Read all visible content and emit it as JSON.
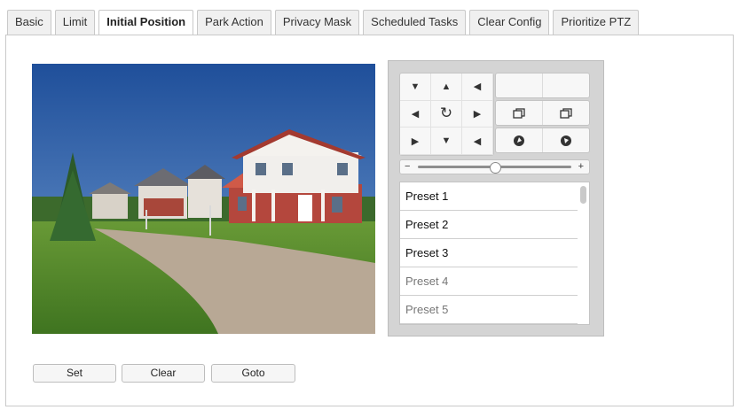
{
  "tabs": [
    {
      "label": "Basic",
      "active": false
    },
    {
      "label": "Limit",
      "active": false
    },
    {
      "label": "Initial Position",
      "active": true
    },
    {
      "label": "Park Action",
      "active": false
    },
    {
      "label": "Privacy Mask",
      "active": false
    },
    {
      "label": "Scheduled Tasks",
      "active": false
    },
    {
      "label": "Clear Config",
      "active": false
    },
    {
      "label": "Prioritize PTZ",
      "active": false
    }
  ],
  "video": {
    "scene": "house-with-lawn-and-road"
  },
  "ptz": {
    "direction_icons": [
      "up-left-arrow-icon",
      "up-arrow-icon",
      "up-right-arrow-icon",
      "left-arrow-icon",
      "auto-rotate-icon",
      "right-arrow-icon",
      "down-left-arrow-icon",
      "down-arrow-icon",
      "down-right-arrow-icon"
    ],
    "direction_glyphs": [
      "▼",
      "▲",
      "◀",
      "◀",
      "↻",
      "▶",
      "▶",
      "▼",
      "◀"
    ],
    "speed_slider": {
      "minus": "−",
      "plus": "+",
      "level": 0.5
    },
    "presets": [
      "Preset 1",
      "Preset 2",
      "Preset 3",
      "Preset 4",
      "Preset 5"
    ]
  },
  "actions": {
    "set_label": "Set",
    "clear_label": "Clear",
    "goto_label": "Goto"
  },
  "colors": {
    "sky": "#2f62a8",
    "grass": "#5a8f2e",
    "road": "#b9a998",
    "house_roof": "#a83a32"
  }
}
